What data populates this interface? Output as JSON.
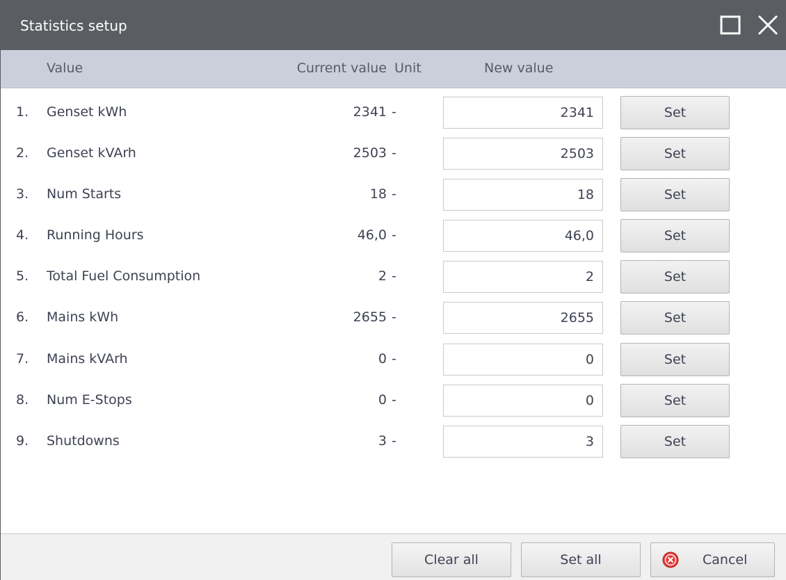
{
  "window": {
    "title": "Statistics setup"
  },
  "columns": {
    "value": "Value",
    "current_value": "Current value",
    "unit": "Unit",
    "new_value": "New value"
  },
  "rows": [
    {
      "num": "1.",
      "name": "Genset kWh",
      "current": "2341",
      "unit": "-",
      "new_value": "2341",
      "set_label": "Set"
    },
    {
      "num": "2.",
      "name": "Genset kVArh",
      "current": "2503",
      "unit": "-",
      "new_value": "2503",
      "set_label": "Set"
    },
    {
      "num": "3.",
      "name": "Num Starts",
      "current": "18",
      "unit": "-",
      "new_value": "18",
      "set_label": "Set"
    },
    {
      "num": "4.",
      "name": "Running Hours",
      "current": "46,0",
      "unit": "-",
      "new_value": "46,0",
      "set_label": "Set"
    },
    {
      "num": "5.",
      "name": "Total Fuel Consumption",
      "current": "2",
      "unit": "-",
      "new_value": "2",
      "set_label": "Set"
    },
    {
      "num": "6.",
      "name": "Mains kWh",
      "current": "2655",
      "unit": "-",
      "new_value": "2655",
      "set_label": "Set"
    },
    {
      "num": "7.",
      "name": "Mains kVArh",
      "current": "0",
      "unit": "-",
      "new_value": "0",
      "set_label": "Set"
    },
    {
      "num": "8.",
      "name": "Num E-Stops",
      "current": "0",
      "unit": "-",
      "new_value": "0",
      "set_label": "Set"
    },
    {
      "num": "9.",
      "name": "Shutdowns",
      "current": "3",
      "unit": "-",
      "new_value": "3",
      "set_label": "Set"
    }
  ],
  "footer": {
    "clear_all_label": "Clear all",
    "set_all_label": "Set all",
    "cancel_label": "Cancel"
  },
  "icons": {
    "maximize": "maximize-icon",
    "close": "close-icon",
    "cancel": "cancel-circle-icon"
  },
  "colors": {
    "titlebar": "#5a5d62",
    "header": "#cbcfdb",
    "cancel_icon": "#e53935"
  }
}
